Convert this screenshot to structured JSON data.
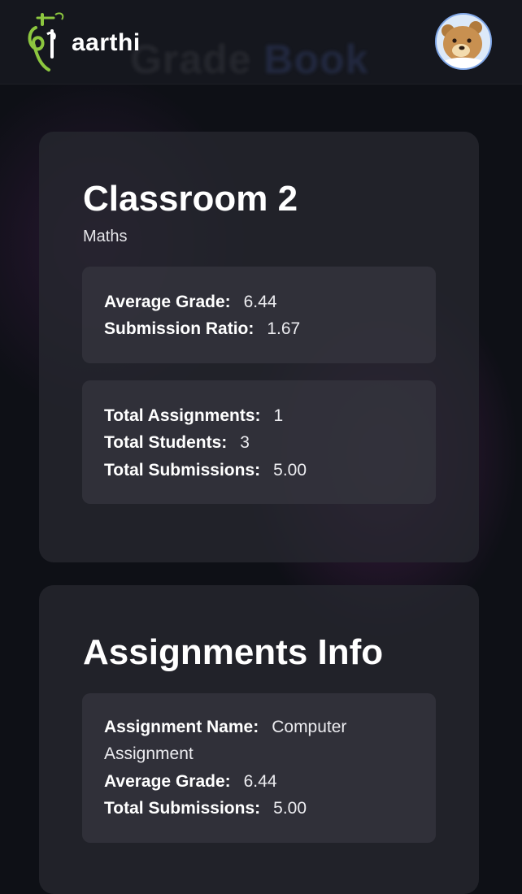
{
  "app": {
    "logo_text": "aarthi",
    "background_title": {
      "part1": "Grade",
      "part2": "Book"
    }
  },
  "classroom": {
    "name": "Classroom 2",
    "subject": "Maths",
    "stats_box_1": {
      "average_grade_label": "Average Grade:",
      "average_grade_value": "6.44",
      "submission_ratio_label": "Submission Ratio:",
      "submission_ratio_value": "1.67"
    },
    "stats_box_2": {
      "total_assignments_label": "Total Assignments:",
      "total_assignments_value": "1",
      "total_students_label": "Total Students:",
      "total_students_value": "3",
      "total_submissions_label": "Total Submissions:",
      "total_submissions_value": "5.00"
    }
  },
  "assignments": {
    "title": "Assignments Info",
    "items": [
      {
        "name_label": "Assignment Name:",
        "name_value_line1": "Computer",
        "name_value_line2": "Assignment",
        "average_grade_label": "Average Grade:",
        "average_grade_value": "6.44",
        "total_submissions_label": "Total Submissions:",
        "total_submissions_value": "5.00"
      }
    ]
  },
  "colors": {
    "background": "#0e1016",
    "card": "#26282f",
    "inner_box": "#34343e",
    "logo_green": "#8cc63f",
    "avatar_border": "#7fa6e6"
  },
  "icons": {
    "logo": "aarthi-logo-icon",
    "avatar": "user-avatar-bear"
  }
}
